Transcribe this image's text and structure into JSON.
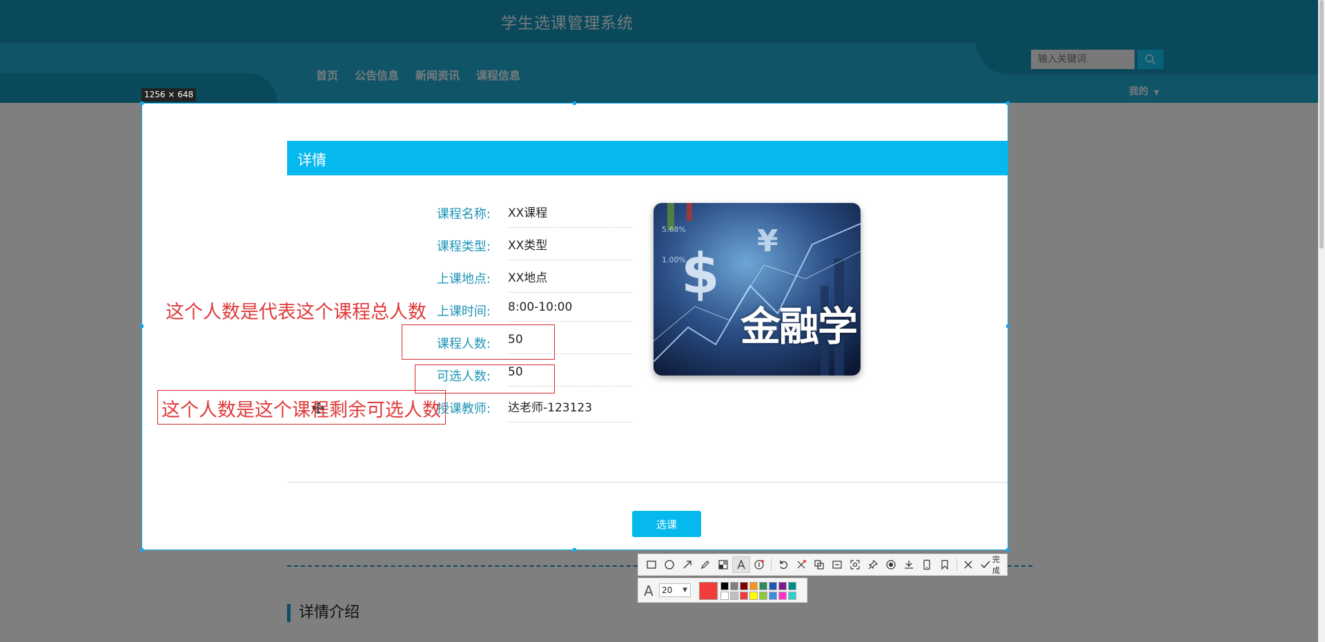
{
  "site": {
    "title": "学生选课管理系统",
    "search_placeholder": "输入关键词",
    "nav": [
      "首页",
      "公告信息",
      "新闻资讯",
      "课程信息"
    ],
    "user_menu": "我的"
  },
  "capture": {
    "size_label": "1256 × 648"
  },
  "detail": {
    "title": "详情",
    "fields": [
      {
        "label": "课程名称:",
        "value": "XX课程"
      },
      {
        "label": "课程类型:",
        "value": "XX类型"
      },
      {
        "label": "上课地点:",
        "value": "XX地点"
      },
      {
        "label": "上课时间:",
        "value": "8:00-10:00"
      },
      {
        "label": "课程人数:",
        "value": "50"
      },
      {
        "label": "可选人数:",
        "value": "50"
      },
      {
        "label": "授课教师:",
        "value": "达老师-123123"
      }
    ],
    "image_text": "金融学",
    "select_button": "选课"
  },
  "intro": {
    "title": "详情介绍"
  },
  "annotations": {
    "note_total": "这个人数是代表这个课程总人数",
    "note_remaining": "这个人数是这个课程剩余可选人数"
  },
  "toolbar": {
    "tools": [
      "rectangle-icon",
      "ellipse-icon",
      "arrow-icon",
      "pen-icon",
      "mosaic-icon",
      "text-icon",
      "number-icon",
      "undo-icon",
      "pin-icon",
      "ocr-icon",
      "long-screenshot-icon",
      "translate-icon",
      "target-icon",
      "download-icon",
      "phone-icon",
      "bookmark-icon",
      "close-icon"
    ],
    "done_label": "完成",
    "font_size": "20",
    "current_color": "#f23c3c",
    "palette": [
      "#000000",
      "#808080",
      "#800000",
      "#f7931e",
      "#2e8b57",
      "#1e5ab4",
      "#7d1a8c",
      "#008b8b",
      "#ffffff",
      "#c0c0c0",
      "#f23c3c",
      "#ffff00",
      "#8dc63f",
      "#3c8ddc",
      "#ff33cc",
      "#33cccc"
    ]
  },
  "colors": {
    "header": "#21a9cf",
    "header_dark": "#1593b6",
    "accent": "#05b9ef",
    "annotation_red": "#e03a3a"
  }
}
